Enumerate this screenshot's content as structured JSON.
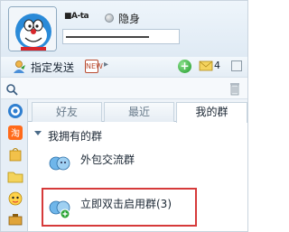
{
  "profile": {
    "nickname": "■A-ta",
    "status_label": "隐身"
  },
  "toolbar": {
    "send_label": "指定发送",
    "calendar_text": "NEW",
    "mail_count": "4"
  },
  "search": {
    "placeholder": ""
  },
  "tabs": [
    {
      "label": "好友"
    },
    {
      "label": "最近"
    },
    {
      "label": "我的群"
    }
  ],
  "groups": {
    "header": "我拥有的群",
    "items": [
      {
        "name": "外包交流群"
      },
      {
        "name": "立即双击启用群(3)"
      }
    ]
  },
  "colors": {
    "highlight": "#d63a3a",
    "accent": "#1f9a2a"
  }
}
